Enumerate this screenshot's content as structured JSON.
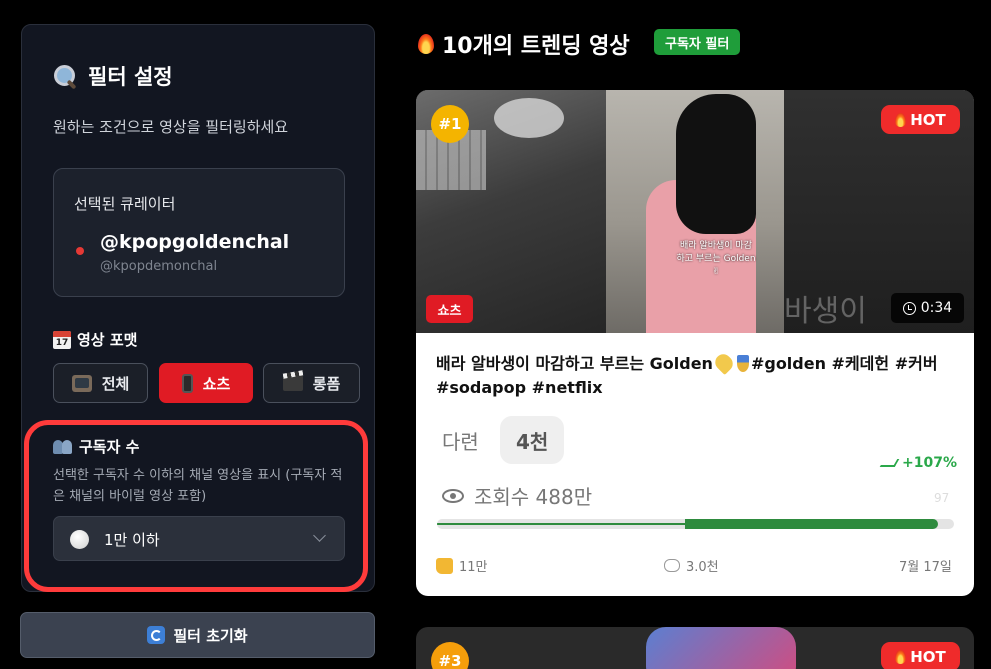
{
  "sidebar": {
    "title": "필터 설정",
    "subtitle": "원하는 조건으로 영상을 필터링하세요",
    "curator": {
      "label": "선택된 큐레이터",
      "name": "@kpopgoldenchal",
      "handle": "@kpopdemonchal"
    },
    "format": {
      "title": "영상 포맷",
      "options": [
        {
          "label": "전체",
          "icon": "tv-icon",
          "active": false
        },
        {
          "label": "쇼츠",
          "icon": "phone-icon",
          "active": true
        },
        {
          "label": "롱폼",
          "icon": "clapper-icon",
          "active": false
        }
      ]
    },
    "subscribers": {
      "title": "구독자 수",
      "description": "선택한 구독자 수 이하의 채널 영상을 표시 (구독자 적은 채널의 바이럴 영상 포함)",
      "selected": "1만 이하"
    },
    "reset_label": "필터 초기화"
  },
  "main": {
    "title": "10개의 트렌딩 영상",
    "filter_badge": "구독자 필터"
  },
  "cards": [
    {
      "rank": "#1",
      "hot": "HOT",
      "type": "쇼츠",
      "duration": "0:34",
      "caption": "배라 알바생이 마감하고 부르는 Golden✌",
      "overlay_ghost": "바생이",
      "title_a": "배라 알바생이 마감하고 부르는 Golden",
      "title_b": "#golden #케데헌 #커버 #sodapop #netflix",
      "creator": "다련",
      "subscriber_chip": "4천",
      "growth": "+107%",
      "views": "조회수 488만",
      "faint_num": "97",
      "progress_fraction": 0.97,
      "likes": "11만",
      "comments": "3.0천",
      "date": "7월 17일"
    },
    {
      "rank": "#3",
      "hot": "HOT"
    }
  ],
  "colors": {
    "accent_red": "#e01b24",
    "green": "#1f9d3a",
    "highlight": "#ff3b3b"
  }
}
